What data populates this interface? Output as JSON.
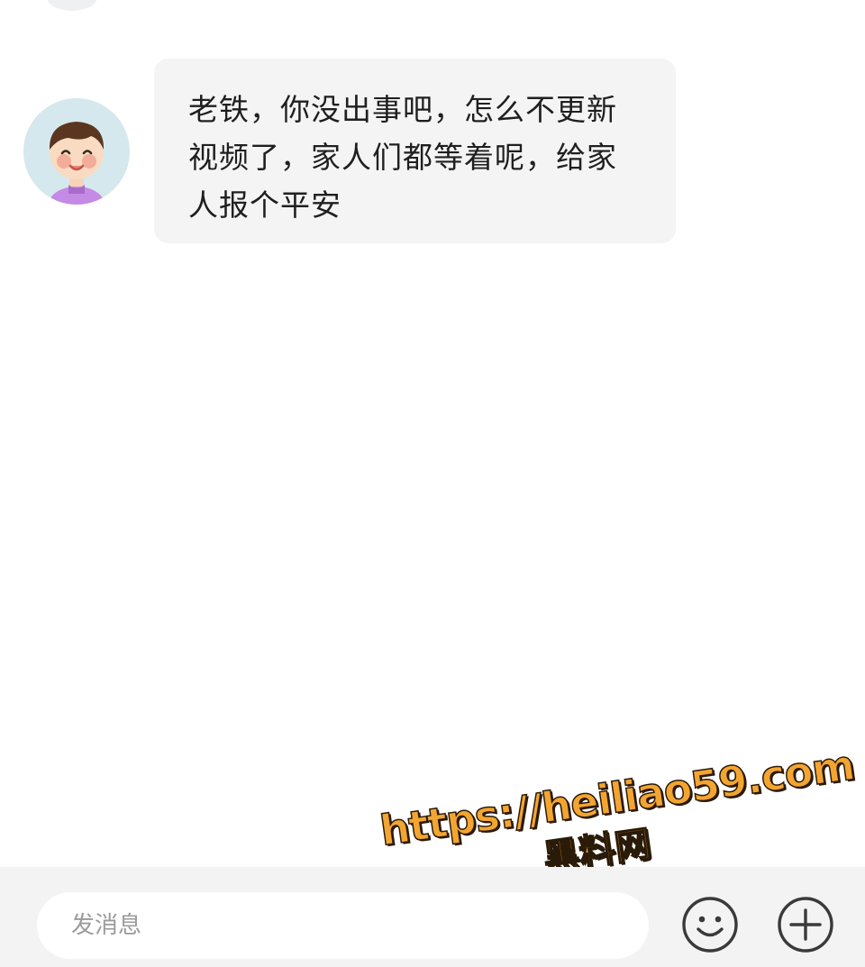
{
  "conversation": {
    "messages": [
      {
        "sender": "other",
        "avatar": "cartoon-child-avatar-icon",
        "text": "老铁，你没出事吧，怎么不更新视频了，家人们都等着呢，给家人报个平安"
      }
    ]
  },
  "input_bar": {
    "placeholder": "发消息",
    "emoji_icon": "smiley-face-icon",
    "more_icon": "plus-circle-icon"
  },
  "watermark": {
    "url": "https://heiliao59.com",
    "name": "黑料网"
  },
  "colors": {
    "bubble_background": "#f4f4f5",
    "input_bar_background": "#f3f3f3",
    "avatar_background": "#d5e8ee",
    "watermark_fill": "#f3a531"
  }
}
